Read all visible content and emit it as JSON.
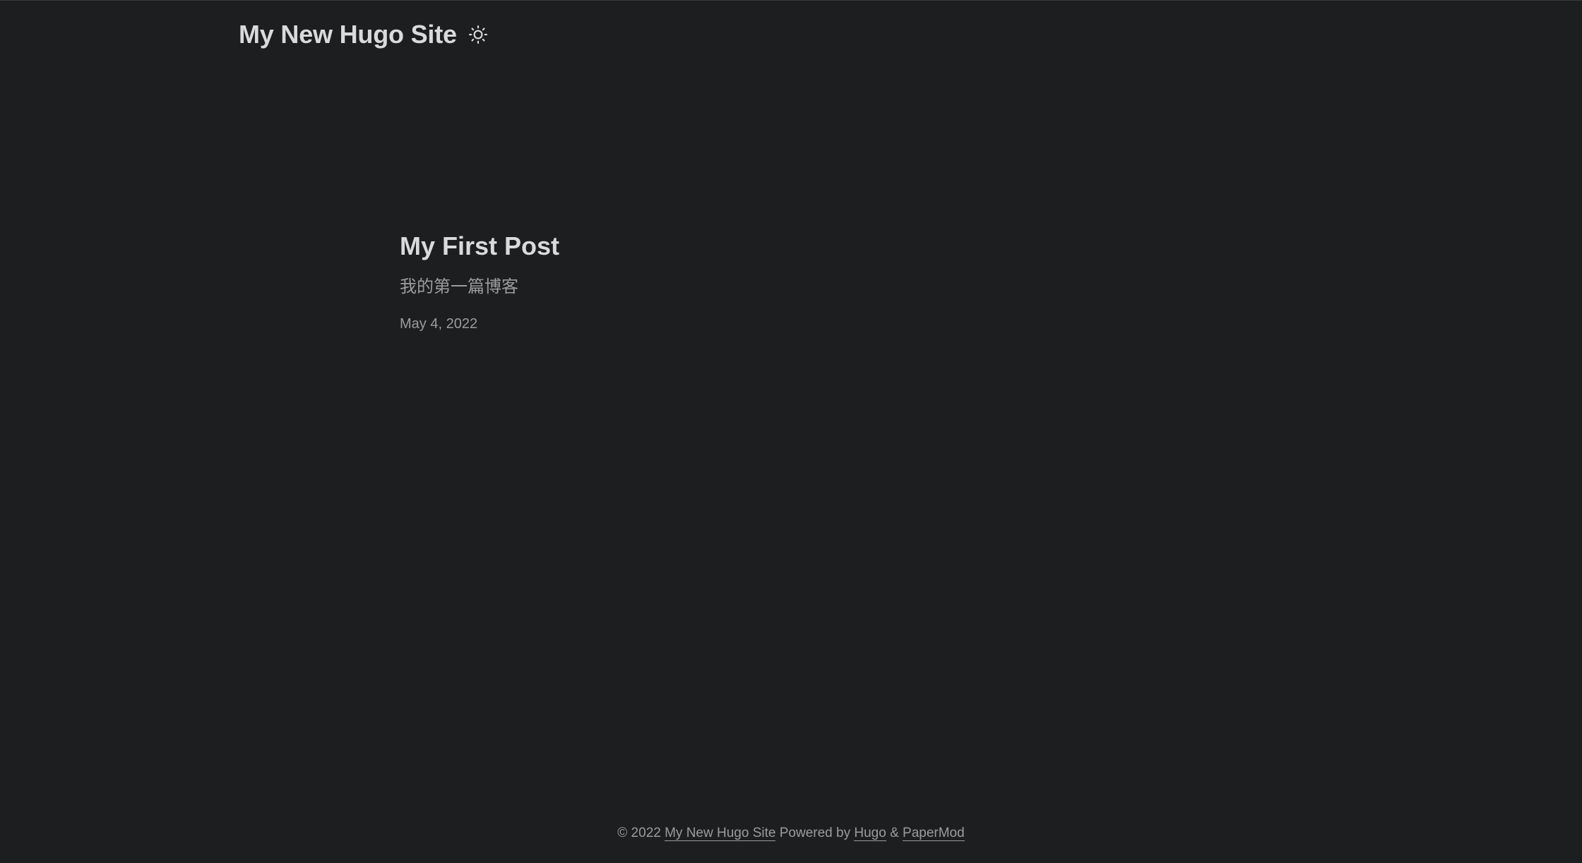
{
  "header": {
    "site_title": "My New Hugo Site",
    "theme_toggle_icon": "sun-icon"
  },
  "post": {
    "title": "My First Post",
    "summary": "我的第一篇博客",
    "date": "May 4, 2022"
  },
  "footer": {
    "copyright": "© 2022",
    "site_link": "My New Hugo Site",
    "powered_by": "Powered by",
    "hugo_link": "Hugo",
    "ampersand": "&",
    "papermod_link": "PaperMod"
  },
  "colors": {
    "background": "#1d1e20",
    "primary_text": "#dadadb",
    "secondary_text": "#9b9c9d"
  }
}
